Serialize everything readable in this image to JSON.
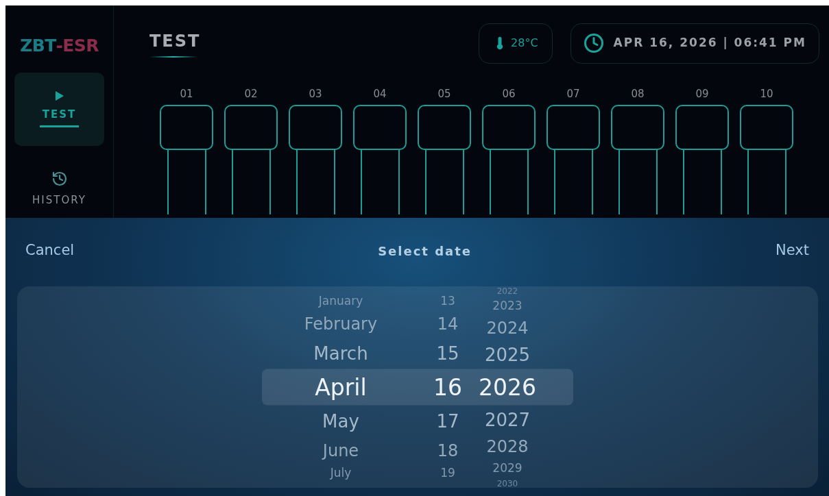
{
  "sidebar": {
    "logo_parts": [
      {
        "text": "ZBT",
        "color": "#1b7c85"
      },
      {
        "text": "-ESR",
        "color": "#8a2c4a"
      }
    ],
    "items": [
      {
        "label": "TEST",
        "kind": "play",
        "selected": true
      },
      {
        "label": "HISTORY",
        "kind": "history",
        "selected": false
      }
    ]
  },
  "header": {
    "title": "TEST",
    "temperature": "28°C",
    "datetime": "APR 16, 2026 | 06:41 PM"
  },
  "slots": [
    {
      "label": "01"
    },
    {
      "label": "02"
    },
    {
      "label": "03"
    },
    {
      "label": "04"
    },
    {
      "label": "05"
    },
    {
      "label": "06"
    },
    {
      "label": "07"
    },
    {
      "label": "08"
    },
    {
      "label": "09"
    },
    {
      "label": "10"
    }
  ],
  "dialog": {
    "cancel": "Cancel",
    "title": "Select date",
    "next": "Next",
    "wheels": [
      {
        "kind": "month",
        "items": [
          {
            "text": "January",
            "selected": false
          },
          {
            "text": "February",
            "selected": false
          },
          {
            "text": "March",
            "selected": false
          },
          {
            "text": "April",
            "selected": true
          },
          {
            "text": "May",
            "selected": false
          },
          {
            "text": "June",
            "selected": false
          },
          {
            "text": "July",
            "selected": false
          }
        ]
      },
      {
        "kind": "day",
        "items": [
          {
            "text": "13",
            "selected": false
          },
          {
            "text": "14",
            "selected": false
          },
          {
            "text": "15",
            "selected": false
          },
          {
            "text": "16",
            "selected": true
          },
          {
            "text": "17",
            "selected": false
          },
          {
            "text": "18",
            "selected": false
          },
          {
            "text": "19",
            "selected": false
          }
        ]
      },
      {
        "kind": "year",
        "items": [
          {
            "text": "2022",
            "selected": false
          },
          {
            "text": "2023",
            "selected": false
          },
          {
            "text": "2024",
            "selected": false
          },
          {
            "text": "2025",
            "selected": false
          },
          {
            "text": "2026",
            "selected": true
          },
          {
            "text": "2027",
            "selected": false
          },
          {
            "text": "2028",
            "selected": false
          },
          {
            "text": "2029",
            "selected": false
          },
          {
            "text": "2030",
            "selected": false
          }
        ]
      }
    ]
  }
}
